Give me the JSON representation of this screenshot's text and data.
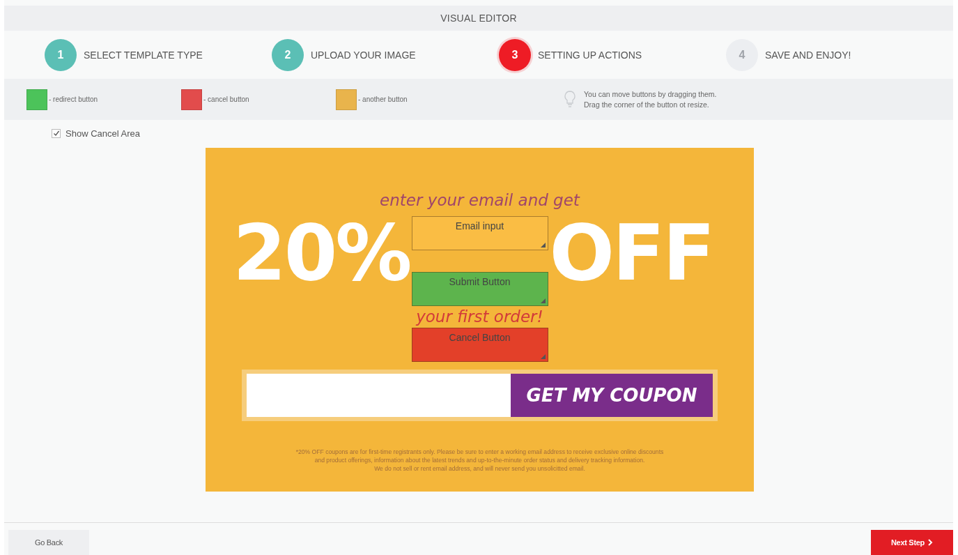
{
  "window": {
    "title": "VISUAL EDITOR"
  },
  "steps": [
    {
      "number": "1",
      "label": "SELECT TEMPLATE TYPE",
      "completed": true,
      "selected": false
    },
    {
      "number": "2",
      "label": "UPLOAD YOUR IMAGE",
      "completed": true,
      "selected": false
    },
    {
      "number": "3",
      "label": "SETTING UP ACTIONS",
      "completed": false,
      "selected": true
    },
    {
      "number": "4",
      "label": "SAVE AND ENJOY!",
      "completed": false,
      "selected": false
    }
  ],
  "legend": [
    {
      "label": "- redirect button",
      "color": "#4cc35a"
    },
    {
      "label": "- cancel button",
      "color": "#e24c4c"
    },
    {
      "label": "- another button",
      "color": "#e9b44c"
    }
  ],
  "hint": {
    "lines": [
      "You can move buttons by dragging them.",
      "Drag the corner of the button ot resize."
    ]
  },
  "show_cancel_area": {
    "label": "Show Cancel Area",
    "checked": true
  },
  "banner": {
    "headline_top": "enter your email and get",
    "headline": [
      "20%",
      "OFF"
    ],
    "headline_bottom": "your first order!",
    "coupon_button": "GET MY COUPON",
    "fine_print": [
      "*20% OFF coupons are for first-time registrants only. Please be sure to enter a working email address to receive exclusive online discounts",
      "and product offerings, information about the latest trends and up-to-the-minute order status and delivery tracking information.",
      "We do not sell or rent email address, and will never send you unsolicitted email."
    ]
  },
  "action_buttons": [
    {
      "label": "Email input",
      "kind": "another"
    },
    {
      "label": "Submit Button",
      "kind": "redirect"
    },
    {
      "label": "Cancel Button",
      "kind": "cancel"
    }
  ],
  "footer": {
    "back": "Go Back",
    "next": "Next Step"
  }
}
